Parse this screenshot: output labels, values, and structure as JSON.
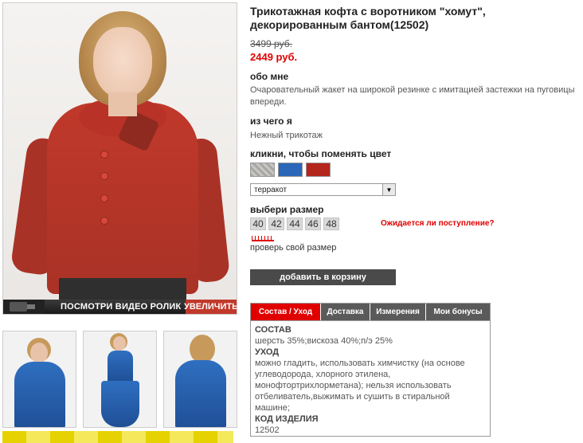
{
  "product": {
    "title": "Трикотажная кофта с воротником \"хомут\", декорированным бантом(12502)",
    "old_price": "3499 руб.",
    "new_price": "2449 руб."
  },
  "about": {
    "heading": "обо мне",
    "text": "Очаровательный жакет на широкой резинке с имитацией застежки на пуговицы впереди."
  },
  "material": {
    "heading": "из чего я",
    "text": "Нежный трикотаж"
  },
  "color": {
    "heading": "кликни, чтобы поменять цвет",
    "swatches": [
      {
        "name": "серый",
        "color": "#a9a7a3"
      },
      {
        "name": "синий",
        "color": "#2a67b8"
      },
      {
        "name": "терракот",
        "color": "#b4261b"
      }
    ],
    "selected": "терракот"
  },
  "size": {
    "heading": "выбери размер",
    "options": [
      "40",
      "42",
      "44",
      "46",
      "48"
    ],
    "waiting_link": "Ожидается ли поступление?",
    "check_link": "проверь свой размер"
  },
  "cart_button": "добавить в корзину",
  "media": {
    "video_label": "ПОСМОТРИ ВИДЕО РОЛИК",
    "zoom_label": "УВЕЛИЧИТЬ"
  },
  "tabs": {
    "items": [
      "Состав / Уход",
      "Доставка",
      "Измерения",
      "Мои бонусы"
    ],
    "active": 0,
    "content": {
      "composition_head": "СОСТАВ",
      "composition": "шерсть 35%;вискоза 40%;п/э 25%",
      "care_head": "УХОД",
      "care": "можно гладить, использовать химчистку (на основе углеводорода, хлорного этилена, монофтортрихлорметана); нельзя использовать отбеливатель,выжимать и сушить в стиральной машине;",
      "code_head": "КОД ИЗДЕЛИЯ",
      "code": "12502"
    }
  },
  "colors": {
    "accent_red": "#e00000",
    "dark_button": "#4a4a4a",
    "tab_inactive": "#5a5a5a"
  }
}
